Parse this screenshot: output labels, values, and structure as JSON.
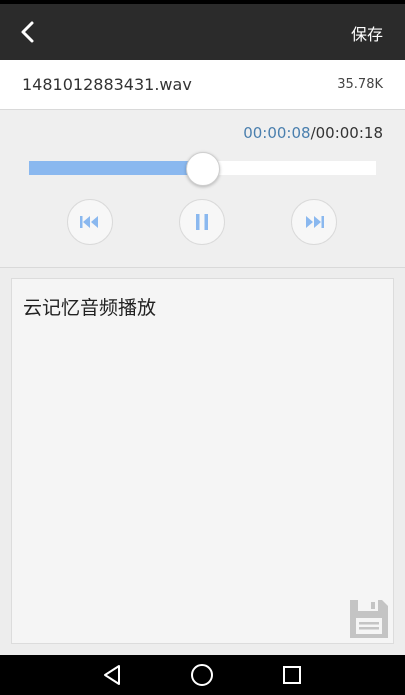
{
  "header": {
    "save_label": "保存"
  },
  "file": {
    "name": "1481012883431.wav",
    "size": "35.78K"
  },
  "player": {
    "current_time": "00:00:08",
    "separator": "/",
    "total_time": "00:00:18",
    "progress": 0.5,
    "accent_color": "#8ab8ef"
  },
  "note": {
    "text": "云记忆音频播放"
  },
  "icons": {
    "back": "back-arrow-icon",
    "prev": "skip-previous-icon",
    "pause": "pause-icon",
    "next": "skip-next-icon",
    "save": "floppy-disk-icon",
    "nav_back": "nav-back-icon",
    "nav_home": "nav-home-icon",
    "nav_recent": "nav-recent-icon"
  }
}
